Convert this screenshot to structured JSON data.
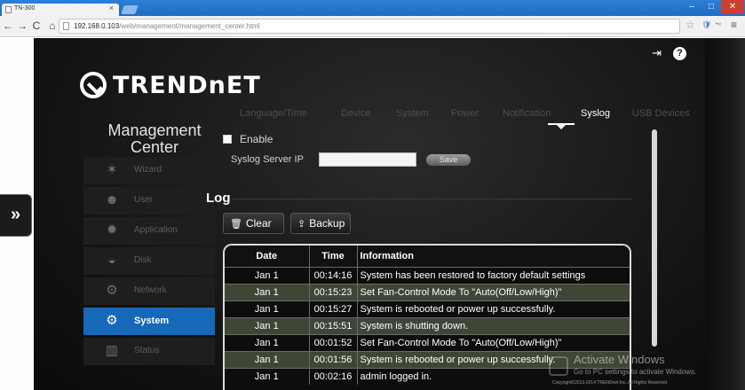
{
  "browser": {
    "tab_title": "TN-300",
    "tab_close": "×",
    "url_host": "192.168.0.103",
    "url_path": "/web/management/management_center.html",
    "nav": {
      "back": "←",
      "forward": "→",
      "reload": "C",
      "home": "⌂"
    },
    "window_controls": {
      "minimize": "–",
      "maximize": "□",
      "close": "✕"
    },
    "extra_icons": {
      "star": "☆",
      "menu": "≡",
      "ext1": "🛡",
      "ext2": "•«"
    }
  },
  "app": {
    "brand": "TRENDnET",
    "title_line1": "Management",
    "title_line2": "Center",
    "side_toggle": "»",
    "header_icons": {
      "logout": "⇥",
      "help": "?"
    },
    "nav_items": [
      {
        "label": "Wizard",
        "icon": "wizard-icon",
        "glyph": "✶"
      },
      {
        "label": "User",
        "icon": "user-icon",
        "glyph": "☻"
      },
      {
        "label": "Application",
        "icon": "application-icon",
        "glyph": "✹"
      },
      {
        "label": "Disk",
        "icon": "disk-icon",
        "glyph": "◒"
      },
      {
        "label": "Network",
        "icon": "network-icon",
        "glyph": "⚙"
      },
      {
        "label": "System",
        "icon": "system-icon",
        "glyph": "⚙",
        "active": true
      },
      {
        "label": "Status",
        "icon": "status-icon",
        "glyph": "▥"
      }
    ],
    "tabs": [
      "Language/Time",
      "Device",
      "System",
      "Power",
      "Notification",
      "Syslog",
      "USB Devices"
    ],
    "active_tab": "Syslog",
    "enable_label": "Enable",
    "syslog_server_label": "Syslog Server IP",
    "syslog_server_value": "",
    "save_label": "Save",
    "log_title": "Log",
    "clear_label": "Clear",
    "backup_label": "Backup",
    "log_columns": [
      "Date",
      "Time",
      "Information"
    ],
    "log_rows": [
      [
        "Jan 1",
        "00:14:16",
        "System has been restored to factory default settings"
      ],
      [
        "Jan 1",
        "00:15:23",
        "Set Fan-Control Mode To \"Auto(Off/Low/High)\""
      ],
      [
        "Jan 1",
        "00:15:27",
        "System is rebooted or power up successfully."
      ],
      [
        "Jan 1",
        "00:15:51",
        "System is shutting down."
      ],
      [
        "Jan 1",
        "00:01:52",
        "Set Fan-Control Mode To \"Auto(Off/Low/High)\""
      ],
      [
        "Jan 1",
        "00:01:56",
        "System is rebooted or power up successfully."
      ],
      [
        "Jan 1",
        "00:02:16",
        "admin logged in."
      ]
    ],
    "watermark_line1": "Activate Windows",
    "watermark_line2": "Go to PC settings to activate Windows.",
    "copyright": "Copyright©2013-2014 TRENDnet Inc. All Rights Reserved."
  }
}
